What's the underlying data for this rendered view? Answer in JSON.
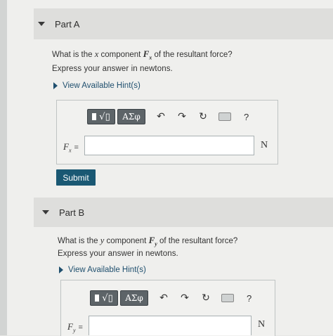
{
  "partA": {
    "title": "Part A",
    "question_pre": "What is the ",
    "question_var": "x",
    "question_mid": " component ",
    "force_symbol": "F",
    "force_sub": "x",
    "question_post": " of the resultant force?",
    "express": "Express your answer in newtons.",
    "hint": "View Available Hint(s)",
    "toolbar": {
      "greek": "ΑΣφ",
      "undo": "↶",
      "redo": "↷",
      "reset": "↻",
      "help": "?"
    },
    "label_symbol": "F",
    "label_sub": "x",
    "label_eq": "=",
    "answer_value": "",
    "unit": "N",
    "submit": "Submit"
  },
  "partB": {
    "title": "Part B",
    "question_pre": "What is the ",
    "question_var": "y",
    "question_mid": " component ",
    "force_symbol": "F",
    "force_sub": "y",
    "question_post": " of the resultant force?",
    "express": "Express your answer in newtons.",
    "hint": "View Available Hint(s)",
    "toolbar": {
      "greek": "ΑΣφ",
      "undo": "↶",
      "redo": "↷",
      "reset": "↻",
      "help": "?"
    },
    "label_symbol": "F",
    "label_sub": "y",
    "label_eq": "=",
    "answer_value": "",
    "unit": "N"
  },
  "colors": {
    "submit": "#1a5873",
    "hint": "#1f4f6e",
    "header": "#dededc"
  }
}
